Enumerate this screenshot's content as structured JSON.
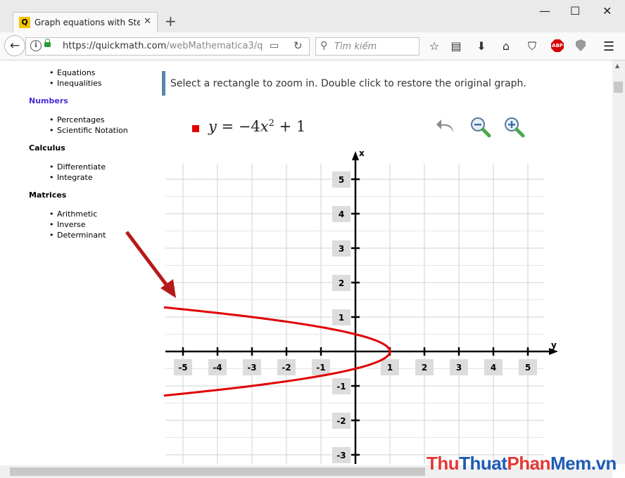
{
  "browser": {
    "tab_title": "Graph equations with Step-by",
    "tab_favicon": "Q",
    "tab_close": "✕",
    "new_tab": "+",
    "window_minimize": "—",
    "window_maximize": "☐",
    "window_close": "✕",
    "url_main": "https://quickmath.com",
    "url_path": "/webMathematica3/q",
    "search_placeholder": "Tìm kiếm",
    "abp_label": "ABP"
  },
  "sidebar": {
    "group1": [
      "Equations",
      "Inequalities"
    ],
    "numbers_heading": "Numbers",
    "numbers_items": [
      "Percentages",
      "Scientific Notation"
    ],
    "calculus_heading": "Calculus",
    "calculus_items": [
      "Differentiate",
      "Integrate"
    ],
    "matrices_heading": "Matrices",
    "matrices_items": [
      "Arithmetic",
      "Inverse",
      "Determinant"
    ]
  },
  "main": {
    "instruction": "Select a rectangle to zoom in. Double click to restore the original graph.",
    "equation_lhs": "y",
    "equation_rhs_a": " = −4",
    "equation_var": "x",
    "equation_exp": "2",
    "equation_rhs_b": " + 1",
    "legend_color": "#e00000"
  },
  "chart_data": {
    "type": "line",
    "title": "",
    "xlabel": "y",
    "ylabel": "x",
    "horizontal_axis_label": "y",
    "vertical_axis_label": "x",
    "horizontal_ticks": [
      -5,
      -4,
      -3,
      -2,
      -1,
      1,
      2,
      3,
      4,
      5
    ],
    "vertical_ticks": [
      5,
      4,
      3,
      2,
      1,
      -1,
      -2,
      -3
    ],
    "xlim": [
      -5.5,
      5.5
    ],
    "ylim": [
      -3.3,
      5.6
    ],
    "grid": true,
    "series": [
      {
        "name": "y = −4x^2 + 1",
        "color": "#e00000",
        "x": [
          -1.28,
          -1.2,
          -1.0,
          -0.8,
          -0.6,
          -0.4,
          -0.2,
          0.0,
          0.2,
          0.4,
          0.5,
          0.4,
          0.2,
          0.0,
          -0.2,
          -0.4,
          -0.6,
          -0.8,
          -1.0,
          -1.2,
          -1.28
        ],
        "y": [
          -5.55,
          -4.76,
          -3.0,
          -1.56,
          -0.44,
          0.36,
          0.84,
          1.0,
          0.84,
          0.36,
          0.0,
          0.36,
          0.84,
          1.0,
          0.84,
          0.36,
          -0.44,
          -1.56,
          -3.0,
          -4.76,
          -5.55
        ],
        "note_branch": "upper-branch-first"
      }
    ]
  },
  "watermark": {
    "part1": "Thu",
    "part2": "Thuat",
    "part3": "Phan",
    "part4": "Mem",
    "part5": ".vn"
  }
}
